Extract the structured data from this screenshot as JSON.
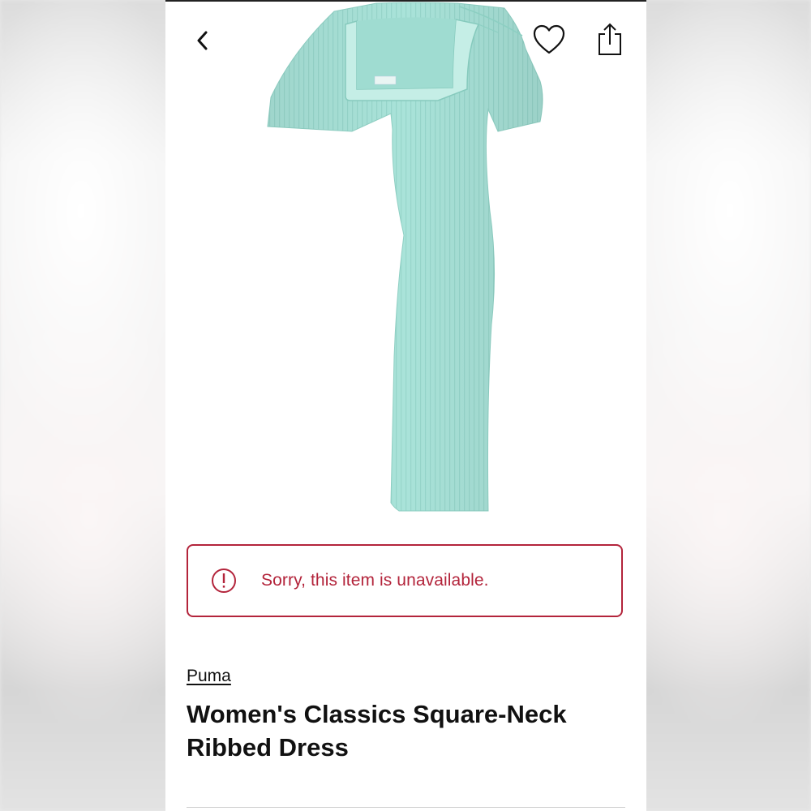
{
  "header": {
    "back_icon": "chevron-left-icon",
    "favorite_icon": "heart-outline-icon",
    "share_icon": "share-icon"
  },
  "product": {
    "image_subject": "mint ribbed short-sleeve dress",
    "image_color": "#a8e4d9",
    "brand": "Puma",
    "title": "Women's Classics Square-Neck Ribbed Dress"
  },
  "alert": {
    "icon": "exclamation-circle-icon",
    "message": "Sorry, this item is unavailable.",
    "color": "#b3243b"
  }
}
